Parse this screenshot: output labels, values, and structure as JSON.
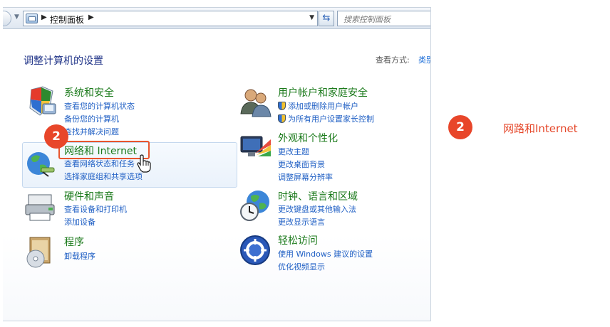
{
  "address_bar": {
    "path_label": "控制面板",
    "search_placeholder": "搜索控制面板"
  },
  "main": {
    "title": "调整计算机的设置",
    "view_by_label": "查看方式:",
    "view_by_value": "类别"
  },
  "categories": {
    "system": {
      "title": "系统和安全",
      "links": [
        "查看您的计算机状态",
        "备份您的计算机",
        "查找并解决问题"
      ]
    },
    "network": {
      "title": "网络和 Internet",
      "links": [
        "查看网络状态和任务",
        "选择家庭组和共享选项"
      ]
    },
    "hardware": {
      "title": "硬件和声音",
      "links": [
        "查看设备和打印机",
        "添加设备"
      ]
    },
    "programs": {
      "title": "程序",
      "links": [
        "卸载程序"
      ]
    },
    "user_accounts": {
      "title": "用户帐户和家庭安全",
      "links": [
        "添加或删除用户帐户",
        "为所有用户设置家长控制"
      ]
    },
    "appearance": {
      "title": "外观和个性化",
      "links": [
        "更改主题",
        "更改桌面背景",
        "调整屏幕分辨率"
      ]
    },
    "clock": {
      "title": "时钟、语言和区域",
      "links": [
        "更改键盘或其他输入法",
        "更改显示语言"
      ]
    },
    "ease": {
      "title": "轻松访问",
      "links": [
        "使用 Windows 建议的设置",
        "优化视频显示"
      ]
    }
  },
  "annotation": {
    "step_number": "2",
    "step_label": "网路和Internet"
  },
  "colors": {
    "accent": "#e8462a",
    "category_title": "#1b7a1b",
    "link": "#1f5fc4"
  }
}
